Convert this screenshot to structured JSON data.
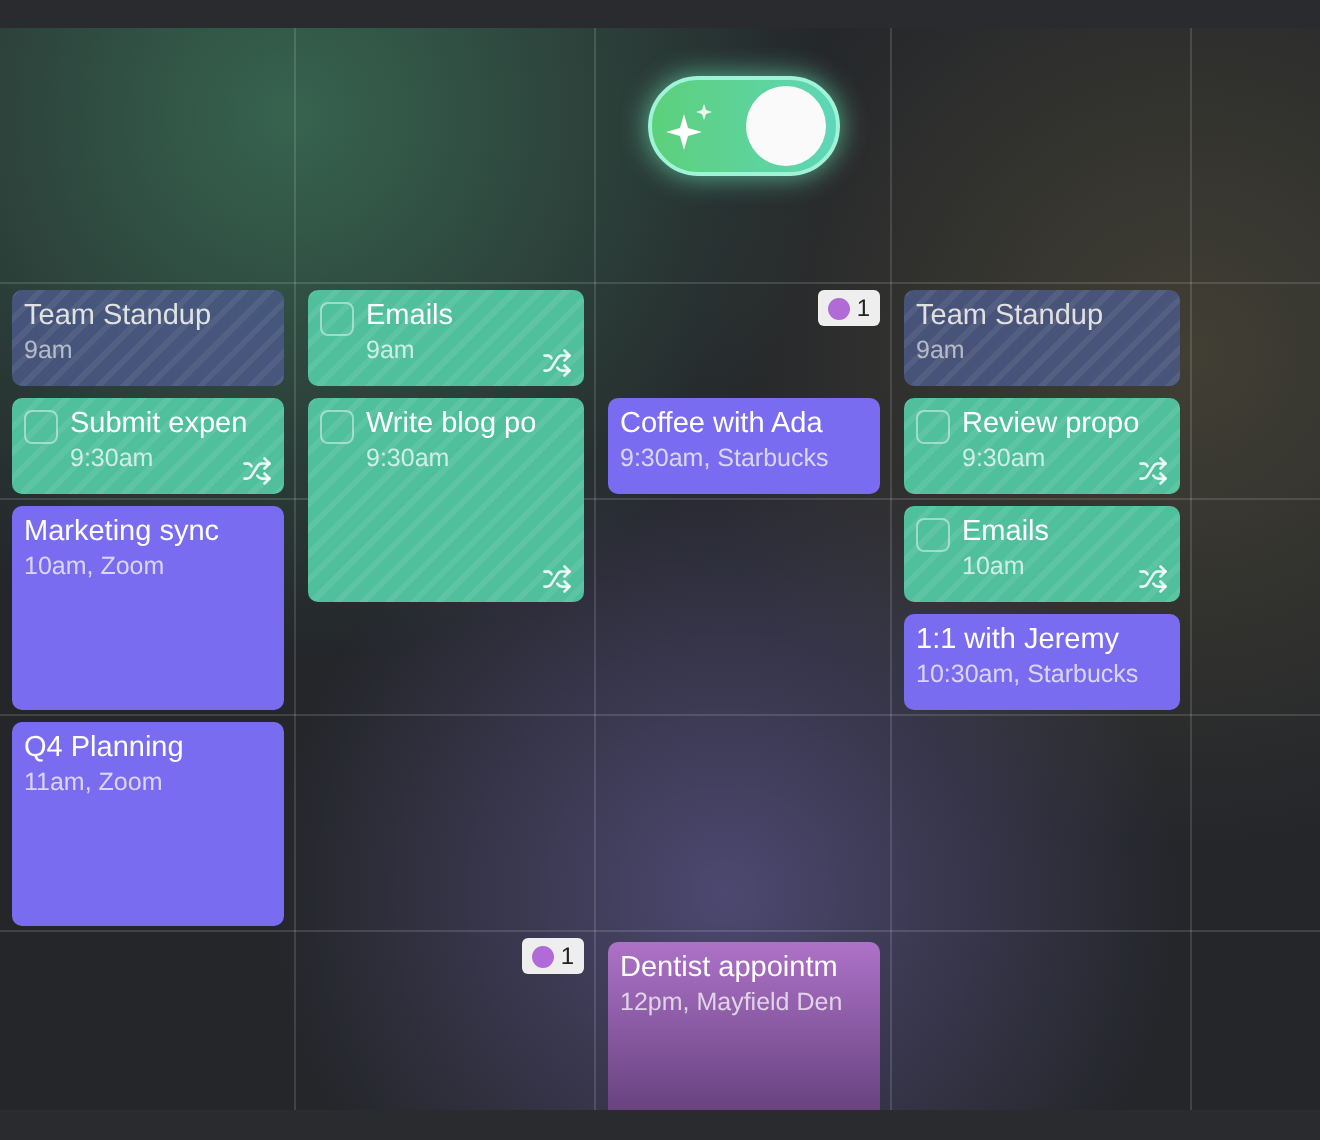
{
  "toggle": {
    "on": true
  },
  "columns": [
    {
      "events": [
        {
          "kind": "busy",
          "title": "Team Standup",
          "subtitle": "9am",
          "color": "#4b5987"
        },
        {
          "kind": "task",
          "title": "Submit expen",
          "subtitle": "9:30am",
          "checked": false,
          "color": "#4fbf9c"
        },
        {
          "kind": "event",
          "title": "Marketing sync",
          "subtitle": "10am, Zoom",
          "color": "#7a6cf0"
        },
        {
          "kind": "event",
          "title": "Q4 Planning",
          "subtitle": "11am, Zoom",
          "color": "#7a6cf0"
        }
      ]
    },
    {
      "badge": {
        "count": "1",
        "color": "#b06bd6"
      },
      "events": [
        {
          "kind": "task",
          "title": "Emails",
          "subtitle": "9am",
          "checked": false,
          "color": "#4fbf9c"
        },
        {
          "kind": "task",
          "title": "Write blog po",
          "subtitle": "9:30am",
          "checked": false,
          "color": "#4fbf9c"
        }
      ]
    },
    {
      "badge": {
        "count": "1",
        "color": "#b06bd6"
      },
      "events": [
        {
          "kind": "event",
          "title": "Coffee with Ada",
          "subtitle": "9:30am, Starbucks",
          "color": "#7a6cf0"
        },
        {
          "kind": "event",
          "title": "Dentist appointm",
          "subtitle": "12pm, Mayfield Den",
          "color": "#a869c4"
        }
      ]
    },
    {
      "events": [
        {
          "kind": "busy",
          "title": "Team Standup",
          "subtitle": "9am",
          "color": "#4b5987"
        },
        {
          "kind": "task",
          "title": "Review propo",
          "subtitle": "9:30am",
          "checked": false,
          "color": "#4fbf9c"
        },
        {
          "kind": "task",
          "title": "Emails",
          "subtitle": "10am",
          "checked": false,
          "color": "#4fbf9c"
        },
        {
          "kind": "event",
          "title": "1:1 with Jeremy",
          "subtitle": "10:30am, Starbucks",
          "color": "#7a6cf0"
        }
      ]
    },
    {}
  ]
}
